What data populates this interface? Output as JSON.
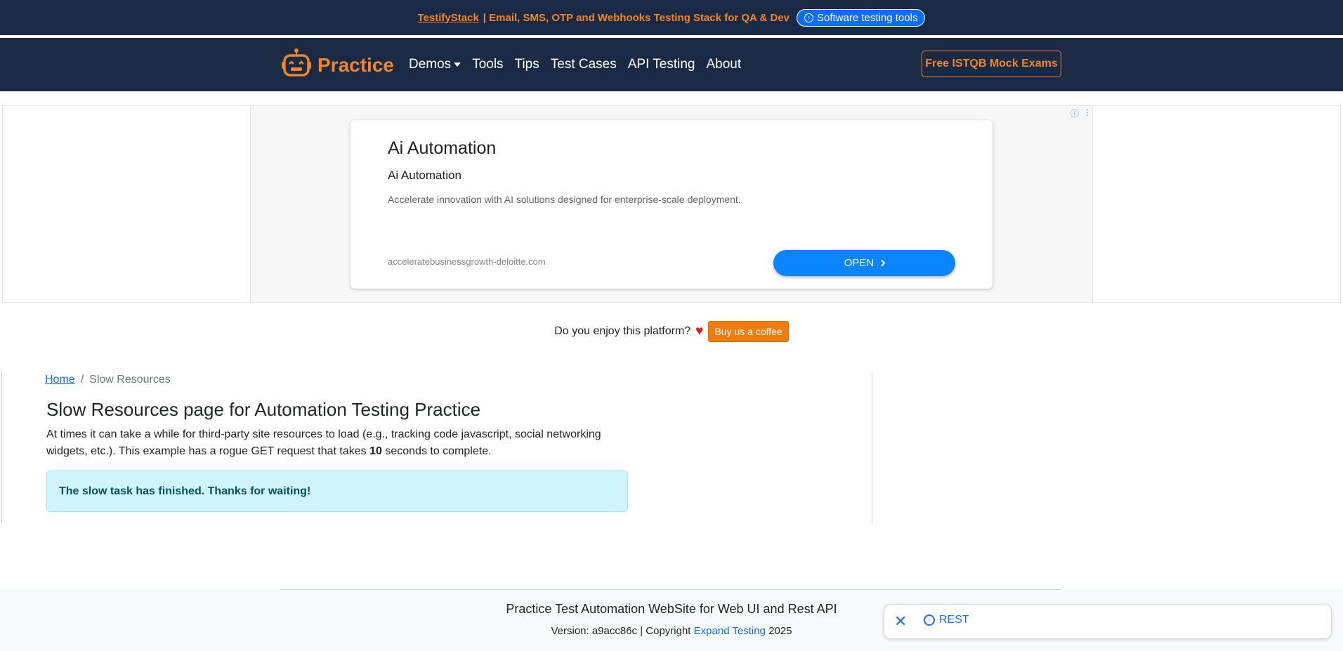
{
  "promo": {
    "brand_link": "TestifyStack",
    "text": "| Email, SMS, OTP and Webhooks Testing Stack for QA & Dev",
    "pill_label": "Software testing tools"
  },
  "navbar": {
    "brand": "Practice",
    "links": [
      "Demos",
      "Tools",
      "Tips",
      "Test Cases",
      "API Testing",
      "About"
    ],
    "cta": "Free ISTQB Mock Exams"
  },
  "ad": {
    "title": "Ai Automation",
    "subtitle": "Ai Automation",
    "description": "Accelerate innovation with AI solutions designed for enterprise-scale deployment.",
    "url": "acceleratebusinessgrowth-deloitte.com",
    "open_label": "OPEN"
  },
  "support": {
    "question": "Do you enjoy this platform?",
    "button": "Buy us a coffee"
  },
  "breadcrumb": {
    "home": "Home",
    "separator": "/",
    "current": "Slow Resources"
  },
  "main": {
    "title": "Slow Resources page for Automation Testing Practice",
    "desc_before": "At times it can take a while for third-party site resources to load (e.g., tracking code javascript, social networking widgets, etc.). This example has a rogue GET request that takes",
    "desc_bold": "10",
    "desc_after": "seconds to complete.",
    "alert": "The slow task has finished. Thanks for waiting!"
  },
  "footer": {
    "title": "Practice Test Automation WebSite for Web UI and Rest API",
    "version_prefix": "Version: a9acc86c | Copyright",
    "company": "Expand Testing",
    "year": "2025"
  },
  "widget": {
    "label": "REST"
  },
  "colors": {
    "navy": "#1a2a44",
    "orange": "#f0852a",
    "link_blue": "#0d6efd",
    "alert_bg": "#cff4fc"
  }
}
